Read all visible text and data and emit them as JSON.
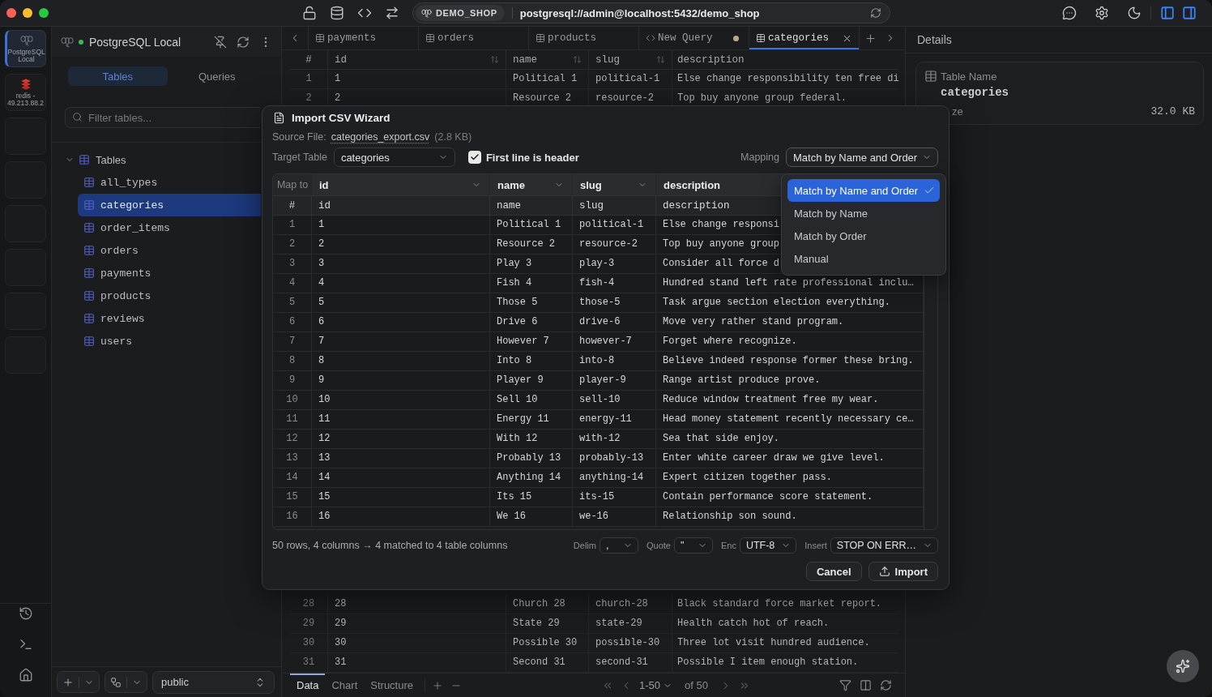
{
  "titlebar": {
    "connection_tag": "DEMO_SHOP",
    "url": "postgresql://admin@localhost:5432/demo_shop",
    "panel_toggles": [
      {
        "kind": "left",
        "on": true
      },
      {
        "kind": "right",
        "on": true
      }
    ]
  },
  "rail": [
    {
      "kind": "postgres",
      "label": "PostgreSQL Local",
      "selected": true
    },
    {
      "kind": "redis",
      "label": "redis - 49.213.88.2",
      "selected": false
    },
    {
      "kind": "empty"
    },
    {
      "kind": "empty"
    },
    {
      "kind": "empty"
    },
    {
      "kind": "empty"
    },
    {
      "kind": "empty"
    },
    {
      "kind": "empty"
    }
  ],
  "sidebar": {
    "connection": {
      "name": "PostgreSQL Local",
      "connected": true
    },
    "tabs": [
      {
        "label": "Tables",
        "selected": true
      },
      {
        "label": "Queries",
        "selected": false
      }
    ],
    "filter": {
      "placeholder": "Filter tables..."
    },
    "tree": [
      {
        "label": "Tables",
        "expanded": true,
        "children": [
          {
            "label": "all_types",
            "selected": false
          },
          {
            "label": "categories",
            "selected": true
          },
          {
            "label": "order_items",
            "selected": false
          },
          {
            "label": "orders",
            "selected": false
          },
          {
            "label": "payments",
            "selected": false
          },
          {
            "label": "products",
            "selected": false
          },
          {
            "label": "reviews",
            "selected": false
          },
          {
            "label": "users",
            "selected": false
          }
        ]
      }
    ],
    "schema": "public"
  },
  "editor_tabs": [
    {
      "label": "payments",
      "kind": "table",
      "selected": false,
      "modified": false
    },
    {
      "label": "orders",
      "kind": "table",
      "selected": false,
      "modified": false
    },
    {
      "label": "products",
      "kind": "table",
      "selected": false,
      "modified": false
    },
    {
      "label": "New Query",
      "kind": "query",
      "selected": false,
      "modified": true
    },
    {
      "label": "categories",
      "kind": "table",
      "selected": true,
      "modified": false
    }
  ],
  "grid": {
    "columns": [
      {
        "label": "#",
        "sortable": false
      },
      {
        "label": "id",
        "sortable": true
      },
      {
        "label": "name",
        "sortable": true
      },
      {
        "label": "slug",
        "sortable": true
      },
      {
        "label": "description",
        "sortable": false
      }
    ],
    "row_groups": [
      [
        [
          "1",
          "1",
          "Political 1",
          "political-1",
          "Else change responsibility ten free di"
        ],
        [
          "2",
          "2",
          "Resource 2",
          "resource-2",
          "Top buy anyone group federal."
        ]
      ],
      [
        [
          "28",
          "28",
          "Church 28",
          "church-28",
          "Black standard force market report."
        ],
        [
          "29",
          "29",
          "State 29",
          "state-29",
          "Health catch hot of reach."
        ],
        [
          "30",
          "30",
          "Possible 30",
          "possible-30",
          "Three lot visit hundred audience."
        ],
        [
          "31",
          "31",
          "Second 31",
          "second-31",
          "Possible I item enough station."
        ]
      ]
    ]
  },
  "result_footer": {
    "tabs": [
      {
        "label": "Data",
        "selected": true
      },
      {
        "label": "Chart",
        "selected": false
      },
      {
        "label": "Structure",
        "selected": false
      }
    ],
    "page_range": "1-50",
    "page_total": "of 50"
  },
  "details": {
    "title": "Details",
    "table_name_label": "Table Name",
    "table_name": "categories",
    "size_label": "ze",
    "size": "32.0 KB"
  },
  "import_dialog": {
    "title": "Import CSV Wizard",
    "source_label": "Source File:",
    "source_file": "categories_export.csv",
    "source_size": "(2.8 KB)",
    "target_label": "Target Table",
    "target_table": "categories",
    "header_option": {
      "label": "First line is header",
      "checked": true
    },
    "mapping_label": "Mapping",
    "mapping_value": "Match by Name and Order",
    "mapping_menu": {
      "expanded": true,
      "options": [
        {
          "label": "Match by Name and Order",
          "selected": true
        },
        {
          "label": "Match by Name",
          "selected": false
        },
        {
          "label": "Match by Order",
          "selected": false
        },
        {
          "label": "Manual",
          "selected": false
        }
      ]
    },
    "map_to_label": "Map to",
    "map_targets": [
      "id",
      "name",
      "slug",
      "description"
    ],
    "columns": [
      "#",
      "id",
      "name",
      "slug",
      "description"
    ],
    "rows": [
      [
        "1",
        "1",
        "Political 1",
        "political-1",
        "Else change responsi"
      ],
      [
        "2",
        "2",
        "Resource 2",
        "resource-2",
        "Top buy anyone group"
      ],
      [
        "3",
        "3",
        "Play 3",
        "play-3",
        "Consider all force d"
      ],
      [
        "4",
        "4",
        "Fish 4",
        "fish-4",
        "Hundred stand left rate professional inclu…"
      ],
      [
        "5",
        "5",
        "Those 5",
        "those-5",
        "Task argue section election everything."
      ],
      [
        "6",
        "6",
        "Drive 6",
        "drive-6",
        "Move very rather stand program."
      ],
      [
        "7",
        "7",
        "However 7",
        "however-7",
        "Forget where recognize."
      ],
      [
        "8",
        "8",
        "Into 8",
        "into-8",
        "Believe indeed response former these bring."
      ],
      [
        "9",
        "9",
        "Player 9",
        "player-9",
        "Range artist produce prove."
      ],
      [
        "10",
        "10",
        "Sell 10",
        "sell-10",
        "Reduce window treatment free my wear."
      ],
      [
        "11",
        "11",
        "Energy 11",
        "energy-11",
        "Head money statement recently necessary ce…"
      ],
      [
        "12",
        "12",
        "With 12",
        "with-12",
        "Sea that side enjoy."
      ],
      [
        "13",
        "13",
        "Probably 13",
        "probably-13",
        "Enter white career draw we give level."
      ],
      [
        "14",
        "14",
        "Anything 14",
        "anything-14",
        "Expert citizen together pass."
      ],
      [
        "15",
        "15",
        "Its 15",
        "its-15",
        "Contain performance score statement."
      ],
      [
        "16",
        "16",
        "We 16",
        "we-16",
        "Relationship son sound."
      ]
    ],
    "summary": "50 rows, 4 columns → 4 matched to 4 table columns",
    "options": [
      {
        "label": "Delim",
        "value": ","
      },
      {
        "label": "Quote",
        "value": "\""
      },
      {
        "label": "Enc",
        "value": "UTF-8"
      },
      {
        "label": "Insert",
        "value": "STOP ON ERR…"
      }
    ],
    "buttons": [
      {
        "label": "Cancel",
        "kind": "cancel"
      },
      {
        "label": "Import",
        "kind": "import"
      }
    ]
  }
}
